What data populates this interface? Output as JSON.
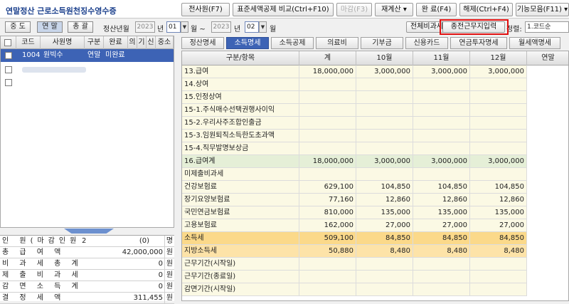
{
  "title": "연말정산 근로소득원천징수영수증",
  "toolbar": {
    "b1": "전사원(F7)",
    "b2": "표준세액공제 비교(Ctrl+F10)",
    "b3": "마감(F3)",
    "b4": "재계산 ▾",
    "b5": "완 료(F4)",
    "b6": "해제(Ctrl+F4)",
    "b7": "기능모음(F11) ▾"
  },
  "filter": {
    "mid": "중 도",
    "year_end": "연 말",
    "total": "총 괄",
    "period_label": "정산년월",
    "year1": "2023",
    "y1": "년",
    "month1": "01",
    "m1": "월 ~",
    "year2": "2023",
    "y2": "년",
    "month2": "02",
    "m2": "월",
    "compare_btn": "전체비과세",
    "prev_work_btn": "종전근무지입력",
    "sort_label": "정렬:",
    "sort_value": "1.코드순"
  },
  "emp_list": {
    "headers": [
      "코드",
      "사원명",
      "구분",
      "완료",
      "의",
      "기",
      "신",
      "중소"
    ],
    "row": {
      "code": "1004",
      "name": "원빅수",
      "type": "연말",
      "done": "미완료"
    }
  },
  "summary": [
    {
      "label": "인 원(마감인원)",
      "value": "2",
      "value2": "(0)",
      "unit": "명"
    },
    {
      "label": "총 급 여 액",
      "value": "42,000,000",
      "unit": "원"
    },
    {
      "label": "비 과 세 총 계",
      "value": "0",
      "unit": "원"
    },
    {
      "label": "제 출 비 과 세",
      "value": "0",
      "unit": "원"
    },
    {
      "label": "감 면 소 득 계",
      "value": "0",
      "unit": "원"
    },
    {
      "label": "결 정 세 액",
      "value": "311,455",
      "unit": "원"
    }
  ],
  "tabs": [
    "정산명세",
    "소득명세",
    "소득공제",
    "의료비",
    "기부금",
    "신용카드",
    "연금투자명세",
    "월세액명세"
  ],
  "grid": {
    "headers": [
      "구분/항목",
      "계",
      "10월",
      "11월",
      "12월",
      "연말"
    ],
    "rows": [
      {
        "label": "13.급여",
        "v": [
          "18,000,000",
          "3,000,000",
          "3,000,000",
          "3,000,000",
          ""
        ],
        "style": ""
      },
      {
        "label": "14.상여",
        "v": [
          "",
          "",
          "",
          "",
          ""
        ],
        "style": ""
      },
      {
        "label": "15.인정상여",
        "v": [
          "",
          "",
          "",
          "",
          ""
        ],
        "style": ""
      },
      {
        "label": "15-1.주식매수선택권행사이익",
        "v": [
          "",
          "",
          "",
          "",
          ""
        ],
        "style": ""
      },
      {
        "label": "15-2.우리사주조합인출금",
        "v": [
          "",
          "",
          "",
          "",
          ""
        ],
        "style": ""
      },
      {
        "label": "15-3.임원퇴직소득한도초과액",
        "v": [
          "",
          "",
          "",
          "",
          ""
        ],
        "style": ""
      },
      {
        "label": "15-4.직무발명보상금",
        "v": [
          "",
          "",
          "",
          "",
          ""
        ],
        "style": ""
      },
      {
        "label": "16.급여계",
        "v": [
          "18,000,000",
          "3,000,000",
          "3,000,000",
          "3,000,000",
          ""
        ],
        "style": "green"
      },
      {
        "label": "미제출비과세",
        "v": [
          "",
          "",
          "",
          "",
          ""
        ],
        "style": ""
      },
      {
        "label": "건강보험료",
        "v": [
          "629,100",
          "104,850",
          "104,850",
          "104,850",
          ""
        ],
        "style": ""
      },
      {
        "label": "장기요양보험료",
        "v": [
          "77,160",
          "12,860",
          "12,860",
          "12,860",
          ""
        ],
        "style": ""
      },
      {
        "label": "국민연금보험료",
        "v": [
          "810,000",
          "135,000",
          "135,000",
          "135,000",
          ""
        ],
        "style": ""
      },
      {
        "label": "고용보험료",
        "v": [
          "162,000",
          "27,000",
          "27,000",
          "27,000",
          ""
        ],
        "style": ""
      },
      {
        "label": "소득세",
        "v": [
          "509,100",
          "84,850",
          "84,850",
          "84,850",
          ""
        ],
        "style": "orange"
      },
      {
        "label": "지방소득세",
        "v": [
          "50,880",
          "8,480",
          "8,480",
          "8,480",
          ""
        ],
        "style": "peach"
      },
      {
        "label": "근무기간(시작일)",
        "v": [
          "",
          "",
          "",
          "",
          ""
        ],
        "style": ""
      },
      {
        "label": "근무기간(종료일)",
        "v": [
          "",
          "",
          "",
          "",
          ""
        ],
        "style": ""
      },
      {
        "label": "감면기간(시작일)",
        "v": [
          "",
          "",
          "",
          "",
          ""
        ],
        "style": ""
      }
    ]
  }
}
